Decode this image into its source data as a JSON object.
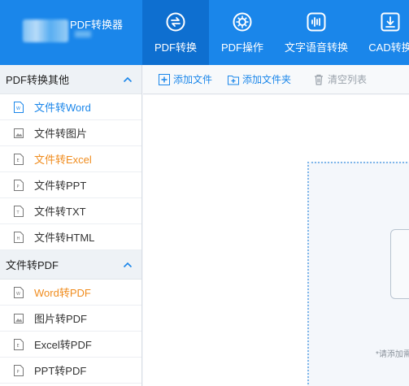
{
  "app": {
    "title": "PDF转换器"
  },
  "nav": {
    "items": [
      {
        "label": "PDF转换",
        "icon": "convert-arrows-icon",
        "active": true
      },
      {
        "label": "PDF操作",
        "icon": "gear-icon"
      },
      {
        "label": "文字语音转换",
        "icon": "audio-wave-icon"
      },
      {
        "label": "CAD转换",
        "icon": "download-box-icon"
      }
    ]
  },
  "sidebar": {
    "group1": {
      "label": "PDF转换其他",
      "items": [
        {
          "label": "文件转Word",
          "state": "selected"
        },
        {
          "label": "文件转图片"
        },
        {
          "label": "文件转Excel",
          "state": "highlight"
        },
        {
          "label": "文件转PPT"
        },
        {
          "label": "文件转TXT"
        },
        {
          "label": "文件转HTML"
        }
      ]
    },
    "group2": {
      "label": "文件转PDF",
      "items": [
        {
          "label": "Word转PDF",
          "state": "highlight"
        },
        {
          "label": "图片转PDF"
        },
        {
          "label": "Excel转PDF"
        },
        {
          "label": "PPT转PDF"
        }
      ]
    }
  },
  "toolbar": {
    "add_file": "添加文件",
    "add_folder": "添加文件夹",
    "clear_list": "清空列表"
  },
  "dropzone": {
    "hint": "*请添加需"
  },
  "colors": {
    "brand": "#1a86ea",
    "active_nav": "#0e6fd0",
    "highlight": "#f08c1e"
  }
}
